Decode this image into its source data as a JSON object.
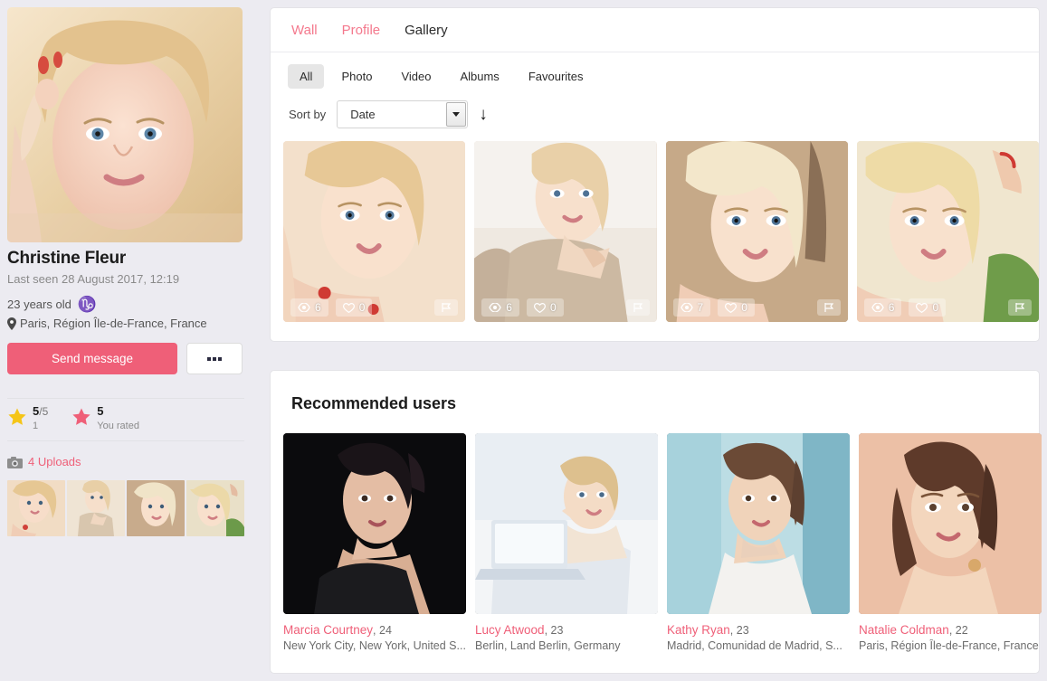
{
  "theme": {
    "accent_pink": "#ef5f78",
    "link_pink": "#f4798d",
    "page_bg": "#ecebf1",
    "zodiac_green": "#5cbf4d",
    "star_gold": "#f5c518"
  },
  "sidebar": {
    "photo_alt": "profile-photo",
    "name": "Christine Fleur",
    "last_seen": "Last seen 28 August 2017, 12:19",
    "age": "23 years old",
    "zodiac_icon": "capricorn-icon",
    "zodiac_glyph": "♑",
    "location_icon": "map-pin-icon",
    "location": "Paris, Région Île-de-France, France",
    "send_message_label": "Send message",
    "more_label": "...",
    "rating": {
      "average_value": "5",
      "average_scale": "/5",
      "votes_count": "1",
      "your_rating_value": "5",
      "your_rating_label": "You rated"
    },
    "uploads": {
      "icon": "camera-icon",
      "label": "4 Uploads",
      "thumbs": [
        "upload-thumb-1",
        "upload-thumb-2",
        "upload-thumb-3",
        "upload-thumb-4"
      ]
    }
  },
  "gallery": {
    "tabs": [
      {
        "label": "Wall",
        "active": false
      },
      {
        "label": "Profile",
        "active": false
      },
      {
        "label": "Gallery",
        "active": true
      }
    ],
    "filters": [
      {
        "label": "All",
        "active": true
      },
      {
        "label": "Photo",
        "active": false
      },
      {
        "label": "Video",
        "active": false
      },
      {
        "label": "Albums",
        "active": false
      },
      {
        "label": "Favourites",
        "active": false
      }
    ],
    "sort": {
      "label": "Sort by",
      "value": "Date",
      "direction_icon": "arrow-down-icon",
      "direction_glyph": "↓"
    },
    "items": [
      {
        "name": "gallery-photo-1",
        "views": "6",
        "likes": "0",
        "flag_icon": "flag-icon"
      },
      {
        "name": "gallery-photo-2",
        "views": "6",
        "likes": "0",
        "flag_icon": "flag-icon"
      },
      {
        "name": "gallery-photo-3",
        "views": "7",
        "likes": "0",
        "flag_icon": "flag-icon"
      },
      {
        "name": "gallery-photo-4",
        "views": "6",
        "likes": "0",
        "flag_icon": "flag-icon"
      }
    ]
  },
  "recommended": {
    "title": "Recommended users",
    "users": [
      {
        "name": "Marcia Courtney",
        "age": ", 24",
        "location": "New York City, New York, United S..."
      },
      {
        "name": "Lucy Atwood",
        "age": ", 23",
        "location": "Berlin, Land Berlin, Germany"
      },
      {
        "name": "Kathy Ryan",
        "age": ", 23",
        "location": "Madrid, Comunidad de Madrid, S..."
      },
      {
        "name": "Natalie Coldman",
        "age": ", 22",
        "location": "Paris, Région Île-de-France, France"
      }
    ]
  }
}
